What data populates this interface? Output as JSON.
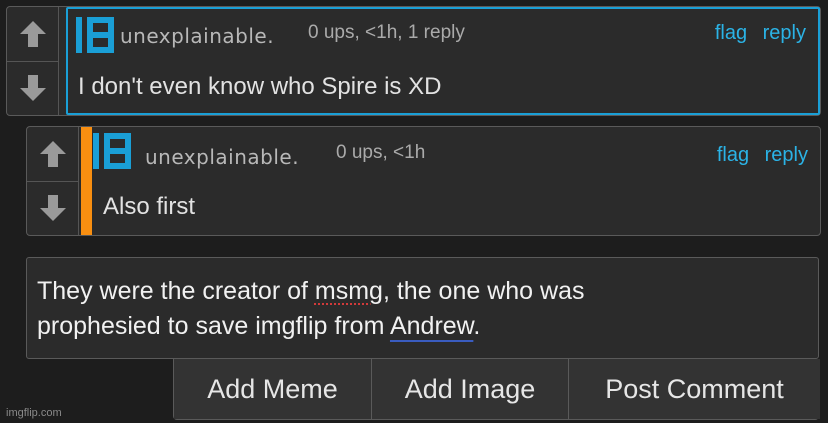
{
  "comment1": {
    "username": "unexplainable.",
    "meta": "0 ups, <1h, 1 reply",
    "flag": "flag",
    "reply": "reply",
    "text": "I don't even know who Spire is XD"
  },
  "comment2": {
    "username": "unexplainable.",
    "meta": "0 ups, <1h",
    "flag": "flag",
    "reply": "reply",
    "text": "Also first"
  },
  "reply_box": {
    "line1_pre": "They were the creator of ",
    "line1_misspelled": "msmg",
    "line1_post": ", the one who was",
    "line2_pre": "prophesied to save imgflip from ",
    "line2_underlined": "Andrew",
    "line2_post": "."
  },
  "buttons": {
    "add_meme": "Add Meme",
    "add_image": "Add Image",
    "post_comment": "Post Comment"
  },
  "watermark": "imgflip.com",
  "colors": {
    "accent_blue": "#1a9fd6",
    "link_blue": "#2bb3e6",
    "orange_bar": "#f98f11",
    "background": "#1d1d1d"
  },
  "icons": {
    "upvote": "arrow-up-icon",
    "downvote": "arrow-down-icon",
    "avatar": "bracket-e-logo-icon"
  }
}
